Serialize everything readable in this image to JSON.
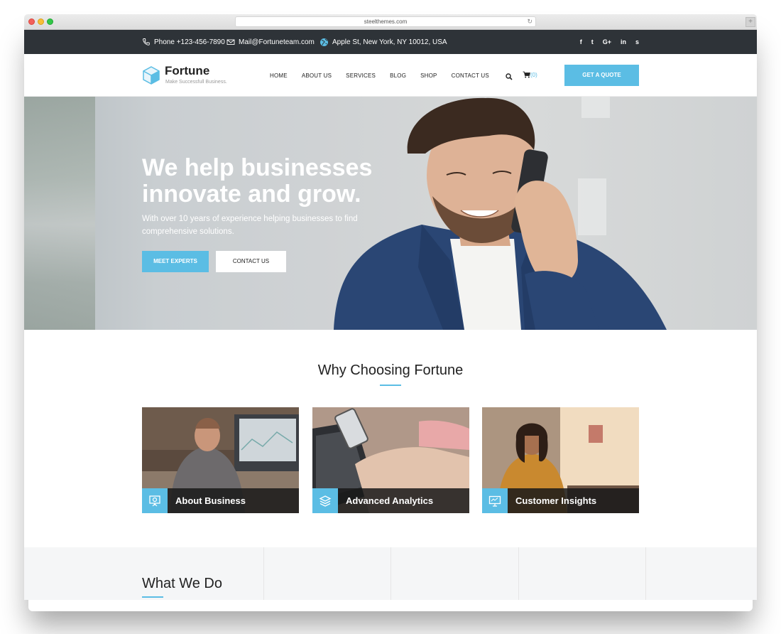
{
  "browser": {
    "url": "steelthemes.com"
  },
  "topbar": {
    "phone": "Phone +123-456-7890",
    "mail": "Mail@Fortuneteam.com",
    "address": "Apple St, New York, NY 10012, USA",
    "social": [
      "f",
      "t",
      "G+",
      "in",
      "s"
    ]
  },
  "brand": {
    "name": "Fortune",
    "tagline": "Make Successfull Business."
  },
  "nav": {
    "items": [
      "HOME",
      "ABOUT US",
      "SERVICES",
      "BLOG",
      "SHOP",
      "CONTACT US"
    ],
    "cart_count": "(0)",
    "quote_label": "GET A QUOTE"
  },
  "hero": {
    "title_line1": "We help businesses",
    "title_line2": "innovate and grow.",
    "subtitle": "With over 10 years of experience helping businesses to find comprehensive solutions.",
    "primary_button": "MEET EXPERTS",
    "secondary_button": "CONTACT US"
  },
  "why": {
    "title": "Why Choosing Fortune",
    "cards": [
      {
        "label": "About Business",
        "icon": "presentation-icon"
      },
      {
        "label": "Advanced Analytics",
        "icon": "layers-icon"
      },
      {
        "label": "Customer Insights",
        "icon": "monitor-icon"
      }
    ]
  },
  "what": {
    "title": "What We Do"
  },
  "colors": {
    "accent": "#5bbde4",
    "topbar": "#2e3338"
  }
}
